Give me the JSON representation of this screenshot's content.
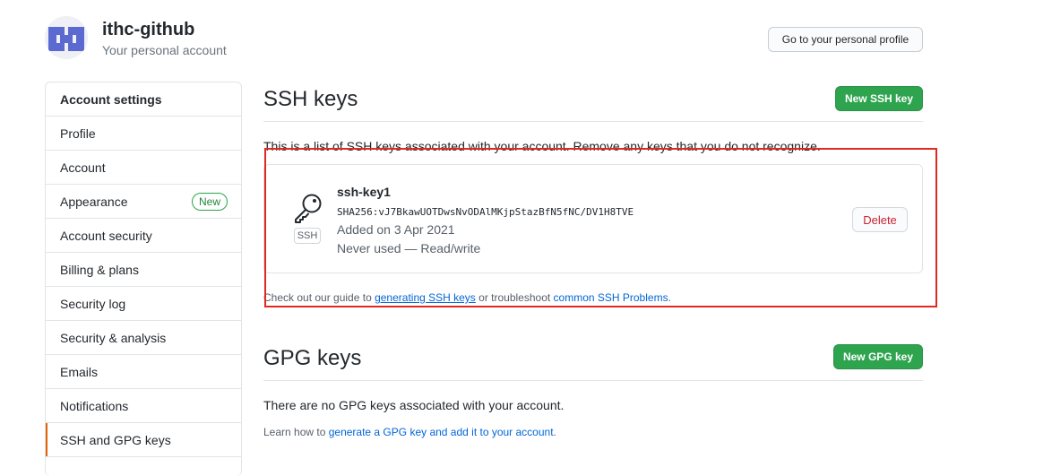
{
  "account": {
    "name": "ithc-github",
    "subtitle": "Your personal account",
    "profile_button": "Go to your personal profile"
  },
  "sidebar": {
    "items": [
      {
        "label": "Account settings"
      },
      {
        "label": "Profile"
      },
      {
        "label": "Account"
      },
      {
        "label": "Appearance",
        "badge": "New"
      },
      {
        "label": "Account security"
      },
      {
        "label": "Billing & plans"
      },
      {
        "label": "Security log"
      },
      {
        "label": "Security & analysis"
      },
      {
        "label": "Emails"
      },
      {
        "label": "Notifications"
      },
      {
        "label": "SSH and GPG keys"
      }
    ]
  },
  "ssh": {
    "title": "SSH keys",
    "new_button": "New SSH key",
    "description": "This is a list of SSH keys associated with your account. Remove any keys that you do not recognize.",
    "key": {
      "badge": "SSH",
      "name": "ssh-key1",
      "fingerprint": "SHA256:vJ7BkawUOTDwsNvODAlMKjpStazBfN5fNC/DV1H8TVE",
      "added": "Added on 3 Apr 2021",
      "usage": "Never used — Read/write",
      "delete_button": "Delete"
    },
    "guide_prefix": "Check out our guide to ",
    "guide_link": "generating SSH keys",
    "guide_middle": " or troubleshoot ",
    "guide_link2": "common SSH Problems",
    "guide_suffix": "."
  },
  "gpg": {
    "title": "GPG keys",
    "new_button": "New GPG key",
    "empty_text": "There are no GPG keys associated with your account.",
    "learn_prefix": "Learn how to ",
    "learn_link": "generate a GPG key and add it to your account",
    "learn_suffix": "."
  },
  "colors": {
    "primary": "#2ea44f",
    "link": "#0366d6",
    "danger": "#cb2431",
    "highlight": "#e0291f",
    "selected_marker": "#e36209"
  },
  "icons": {
    "avatar": "identicon-avatar",
    "key": "key-icon"
  }
}
